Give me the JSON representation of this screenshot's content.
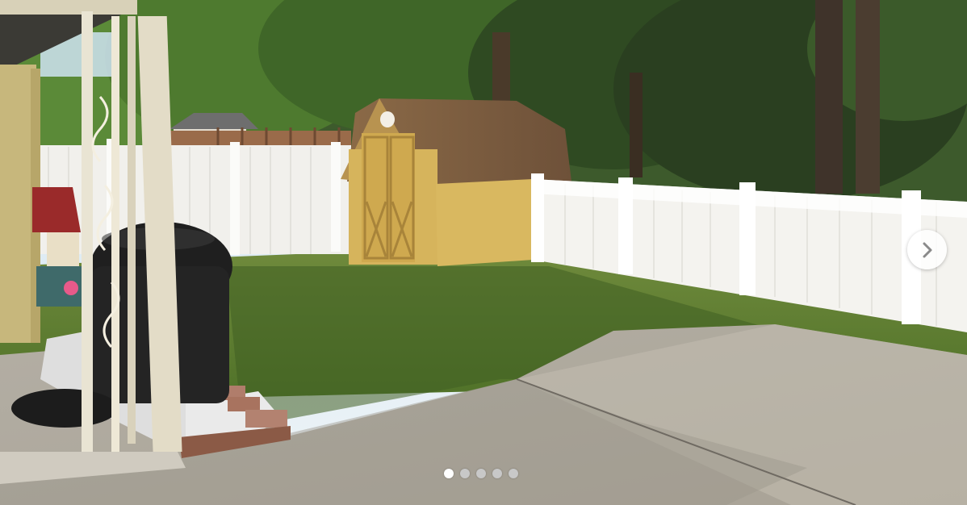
{
  "carousel": {
    "photo_subject": "backyard",
    "next_icon": "chevron-right-icon",
    "slide_count": 5,
    "active_index": 0,
    "colors": {
      "dot_active": "#ffffff",
      "dot_inactive": "#c8c8c8",
      "button_bg": "#ffffff",
      "chevron": "#8a8a8a"
    }
  }
}
